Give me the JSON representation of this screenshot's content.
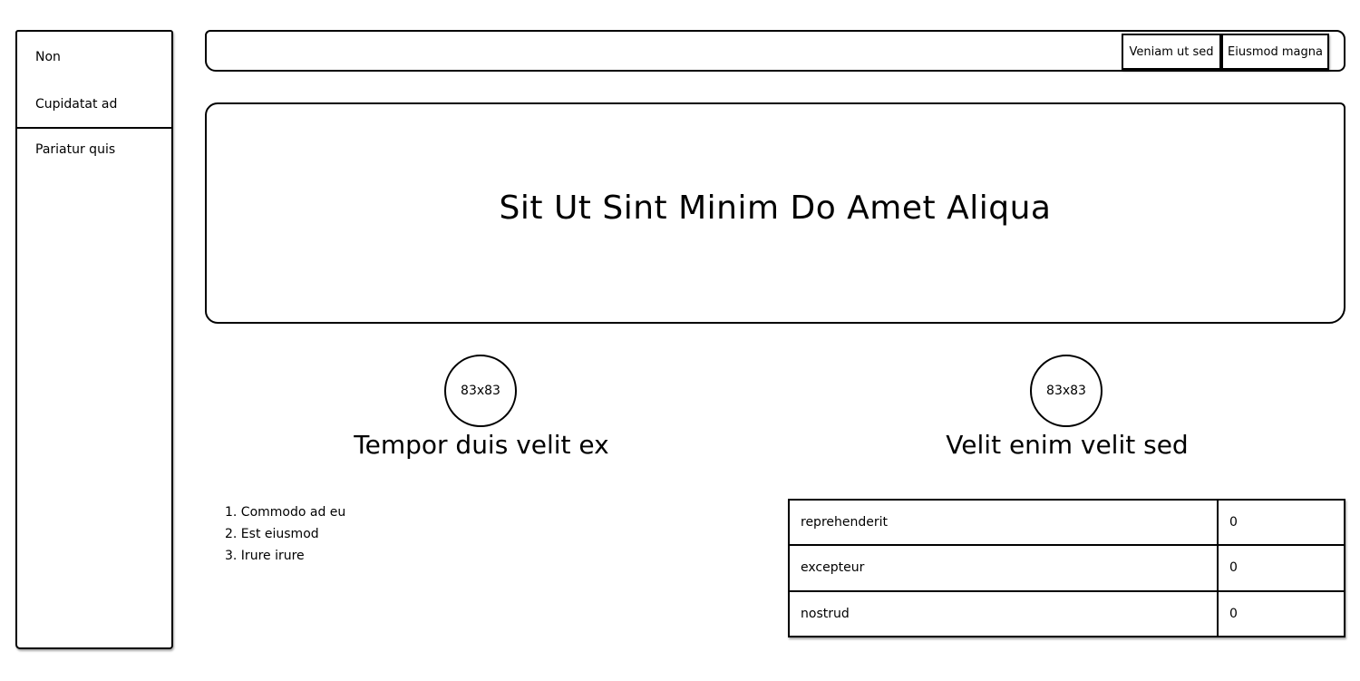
{
  "sidebar": {
    "items": [
      {
        "label": "Non"
      },
      {
        "label": "Cupidatat ad"
      },
      {
        "label": "Pariatur quis"
      }
    ]
  },
  "topbar": {
    "buttons": [
      {
        "label": "Veniam ut sed"
      },
      {
        "label": "Eiusmod magna"
      }
    ]
  },
  "hero": {
    "title": "Sit Ut Sint Minim Do Amet Aliqua"
  },
  "features": [
    {
      "image_label": "83x83",
      "title": "Tempor duis velit ex"
    },
    {
      "image_label": "83x83",
      "title": "Velit enim velit sed"
    }
  ],
  "list": {
    "items": [
      "1. Commodo ad eu",
      "2. Est eiusmod",
      "3. Irure irure"
    ]
  },
  "table": {
    "rows": [
      {
        "name": "reprehenderit",
        "value": "0"
      },
      {
        "name": "excepteur",
        "value": "0"
      },
      {
        "name": "nostrud",
        "value": "0"
      }
    ]
  }
}
